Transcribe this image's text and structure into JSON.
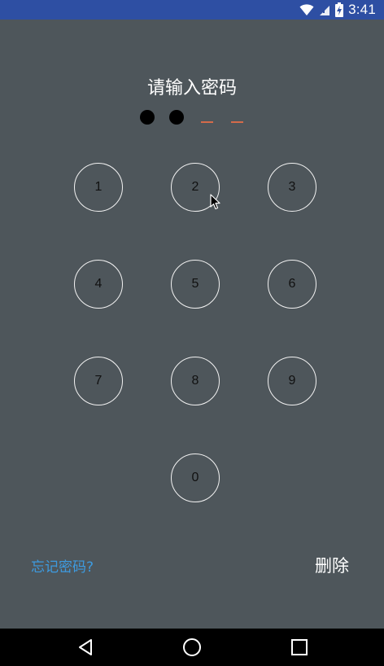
{
  "status_bar": {
    "time": "3:41",
    "icons": [
      "wifi-icon",
      "signal-icon",
      "battery-charging-icon"
    ],
    "color": "#2e4fa3"
  },
  "title": "请输入密码",
  "pin": {
    "length": 4,
    "filled": 2,
    "filled_color": "#000000",
    "empty_color": "#d46b4a"
  },
  "keypad": {
    "keys": [
      "1",
      "2",
      "3",
      "4",
      "5",
      "6",
      "7",
      "8",
      "9",
      "0"
    ]
  },
  "actions": {
    "forgot_label": "忘记密码?",
    "delete_label": "删除"
  },
  "colors": {
    "background": "#4e565b",
    "link": "#3d9be0"
  },
  "nav_bar": {
    "buttons": [
      "back-icon",
      "home-icon",
      "recents-icon"
    ]
  }
}
